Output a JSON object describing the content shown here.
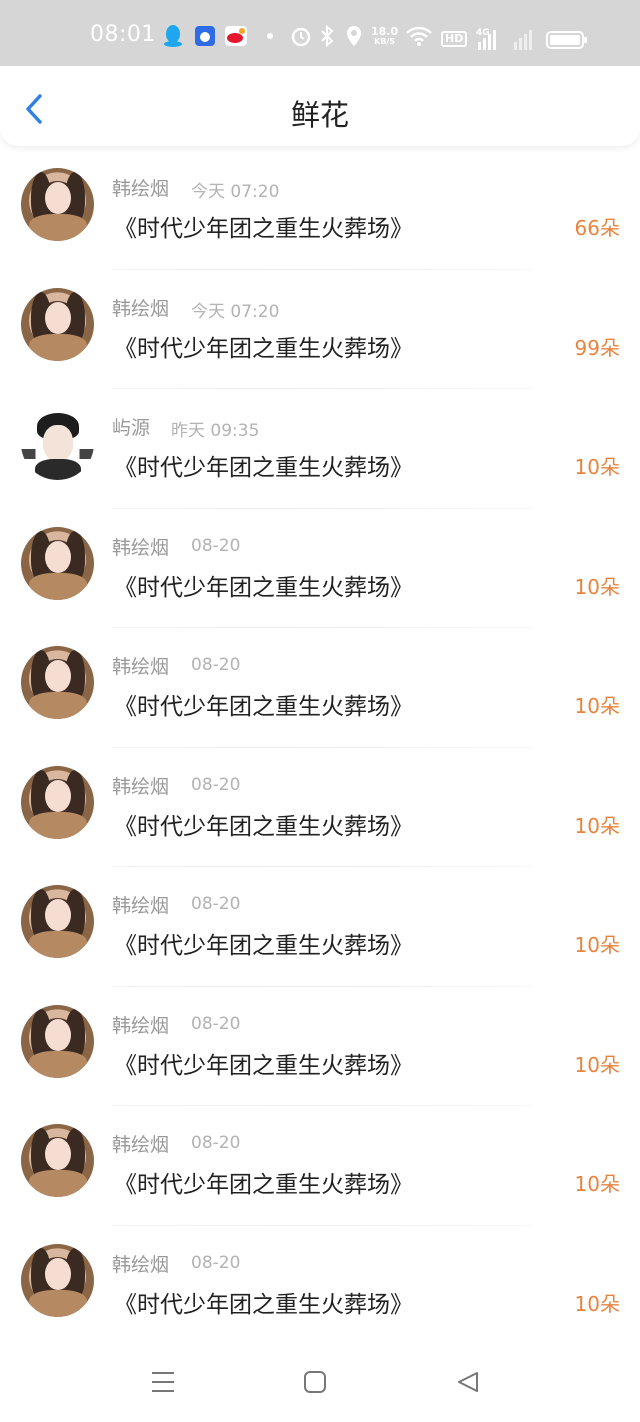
{
  "status_bar": {
    "time": "08:01",
    "speed_value": "18.0",
    "speed_unit": "KB/S",
    "hd": "HD",
    "network": "4G",
    "icons": [
      "qq-icon",
      "baidu-icon",
      "weibo-icon",
      "dot-icon",
      "alarm-icon",
      "bluetooth-icon",
      "location-icon",
      "wifi-icon",
      "signal-icon",
      "battery-icon"
    ]
  },
  "header": {
    "title": "鲜花"
  },
  "items": [
    {
      "name": "韩绘烟",
      "time": "今天 07:20",
      "book": "《时代少年团之重生火葬场》",
      "count": "66朵",
      "avatar": "girl"
    },
    {
      "name": "韩绘烟",
      "time": "今天 07:20",
      "book": "《时代少年团之重生火葬场》",
      "count": "99朵",
      "avatar": "girl"
    },
    {
      "name": "屿源",
      "time": "昨天 09:35",
      "book": "《时代少年团之重生火葬场》",
      "count": "10朵",
      "avatar": "boy"
    },
    {
      "name": "韩绘烟",
      "time": "08-20",
      "book": "《时代少年团之重生火葬场》",
      "count": "10朵",
      "avatar": "girl"
    },
    {
      "name": "韩绘烟",
      "time": "08-20",
      "book": "《时代少年团之重生火葬场》",
      "count": "10朵",
      "avatar": "girl"
    },
    {
      "name": "韩绘烟",
      "time": "08-20",
      "book": "《时代少年团之重生火葬场》",
      "count": "10朵",
      "avatar": "girl"
    },
    {
      "name": "韩绘烟",
      "time": "08-20",
      "book": "《时代少年团之重生火葬场》",
      "count": "10朵",
      "avatar": "girl"
    },
    {
      "name": "韩绘烟",
      "time": "08-20",
      "book": "《时代少年团之重生火葬场》",
      "count": "10朵",
      "avatar": "girl"
    },
    {
      "name": "韩绘烟",
      "time": "08-20",
      "book": "《时代少年团之重生火葬场》",
      "count": "10朵",
      "avatar": "girl"
    },
    {
      "name": "韩绘烟",
      "time": "08-20",
      "book": "《时代少年团之重生火葬场》",
      "count": "10朵",
      "avatar": "girl"
    }
  ],
  "colors": {
    "accent": "#2f7fe6",
    "count": "#e8843e",
    "status_bar": "#d6d6d6"
  },
  "nav": {
    "icons": [
      "menu-icon",
      "home-square-icon",
      "back-triangle-icon"
    ]
  }
}
